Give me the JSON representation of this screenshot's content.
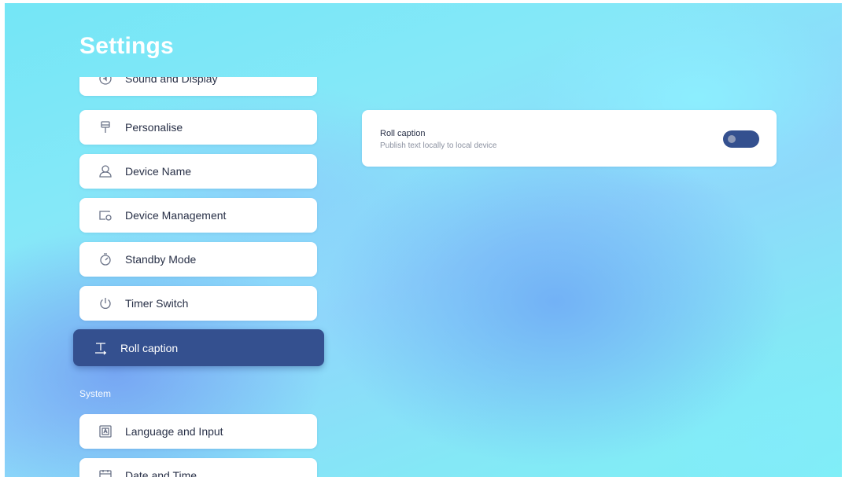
{
  "title": "Settings",
  "menu": {
    "items": [
      {
        "label": "Sound and Display",
        "icon": "sound-display-icon"
      },
      {
        "label": "Personalise",
        "icon": "brush-icon"
      },
      {
        "label": "Device Name",
        "icon": "user-icon"
      },
      {
        "label": "Device Management",
        "icon": "device-management-icon"
      },
      {
        "label": "Standby Mode",
        "icon": "timer-icon"
      },
      {
        "label": "Timer Switch",
        "icon": "power-icon"
      },
      {
        "label": "Roll caption",
        "icon": "text-scroll-icon",
        "active": true
      }
    ],
    "section_label": "System",
    "system_items": [
      {
        "label": "Language and Input",
        "icon": "keyboard-a-icon"
      },
      {
        "label": "Date and Time",
        "icon": "calendar-icon"
      }
    ]
  },
  "detail": {
    "title": "Roll caption",
    "subtitle": "Publish text locally to local device",
    "toggle_on": false
  },
  "colors": {
    "accent": "#34508f",
    "card": "#ffffff",
    "text": "#283047",
    "subtext": "#8b91a0"
  }
}
